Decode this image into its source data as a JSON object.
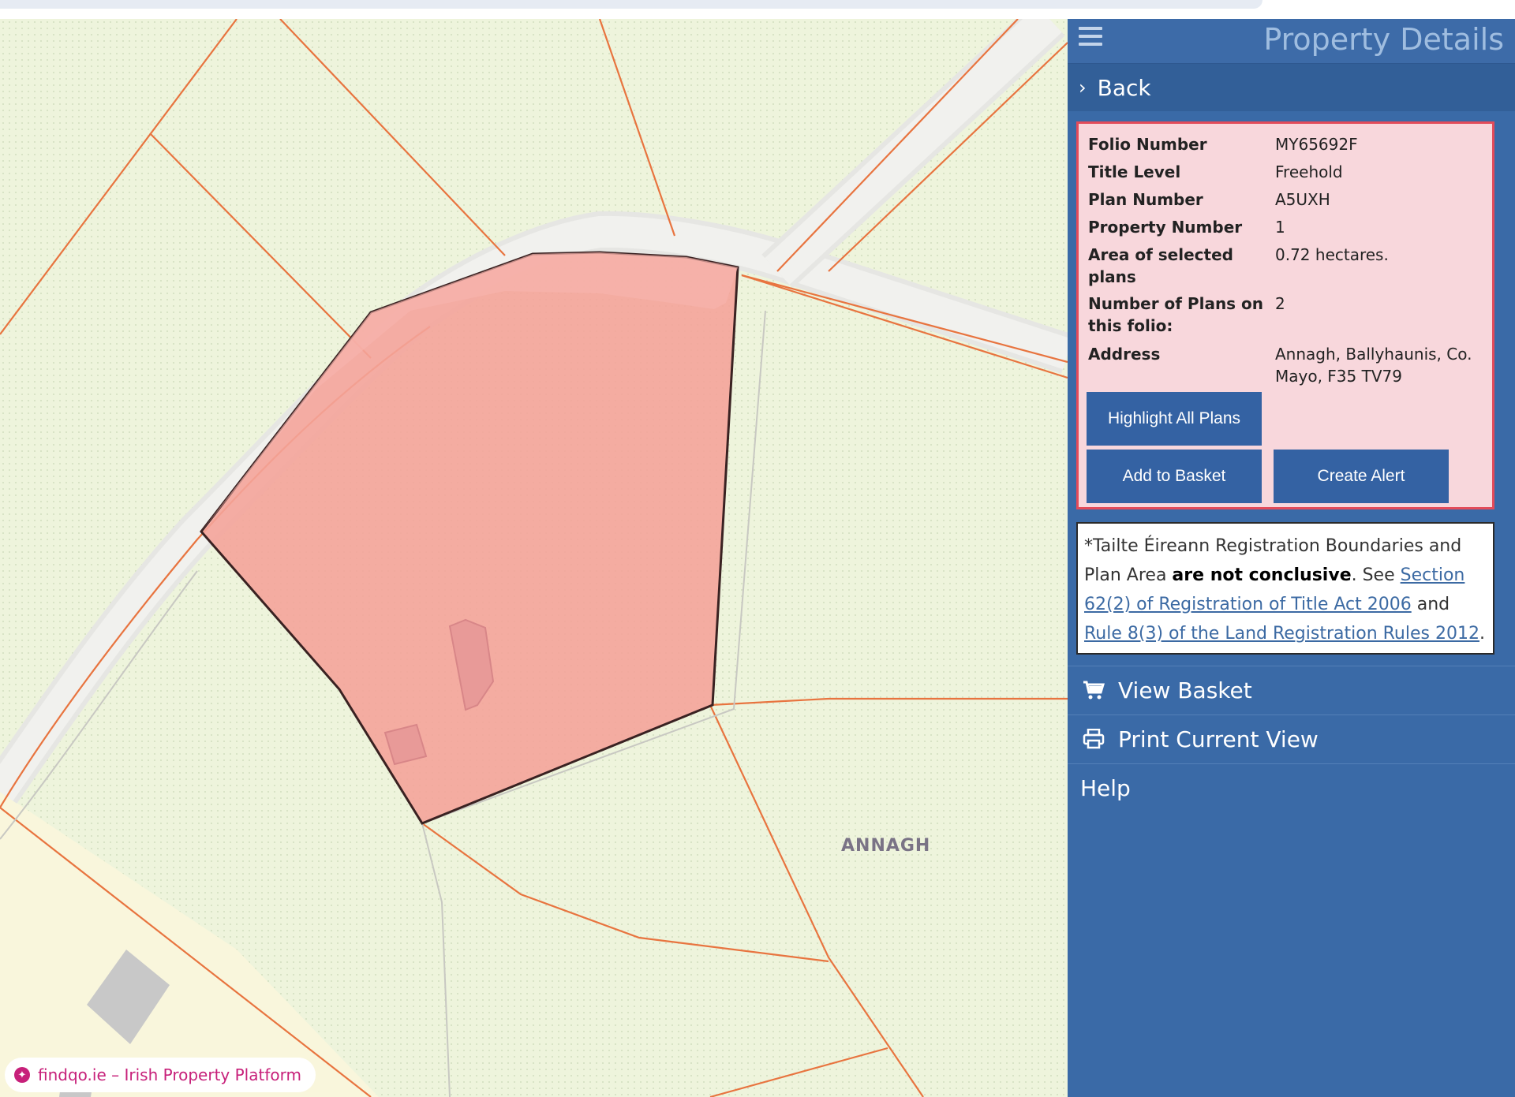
{
  "sidebar": {
    "title": "Property Details",
    "back_label": "Back",
    "details": [
      {
        "label": "Folio Number",
        "value": "MY65692F"
      },
      {
        "label": "Title Level",
        "value": "Freehold"
      },
      {
        "label": "Plan Number",
        "value": "A5UXH"
      },
      {
        "label": "Property Number",
        "value": "1"
      },
      {
        "label": "Area of selected plans",
        "value": "0.72 hectares."
      },
      {
        "label": "Number of Plans on this folio:",
        "value": "2"
      },
      {
        "label": "Address",
        "value": "Annagh, Ballyhaunis, Co. Mayo, F35 TV79"
      }
    ],
    "buttons": {
      "highlight": "Highlight All Plans",
      "add_basket": "Add to Basket",
      "create_alert": "Create Alert"
    },
    "notice": {
      "prefix": "*Tailte Éireann Registration Boundaries and Plan Area ",
      "bold": "are not conclusive",
      "mid": ". See ",
      "link1": "Section 62(2) of Registration of Title Act 2006",
      "and": " and ",
      "link2": "Rule 8(3) of the Land Registration Rules 2012",
      "end": "."
    },
    "menu": [
      {
        "label": "View Basket",
        "icon": "cart-icon"
      },
      {
        "label": "Print Current View",
        "icon": "printer-icon"
      },
      {
        "label": "Help",
        "icon": ""
      }
    ]
  },
  "map": {
    "place_label": "ANNAGH",
    "watermark": "findqo.ie – Irish Property Platform",
    "colors": {
      "highlight_fill": "#f4a49a",
      "boundary": "#e8743f",
      "land": "#eef4dc"
    }
  }
}
